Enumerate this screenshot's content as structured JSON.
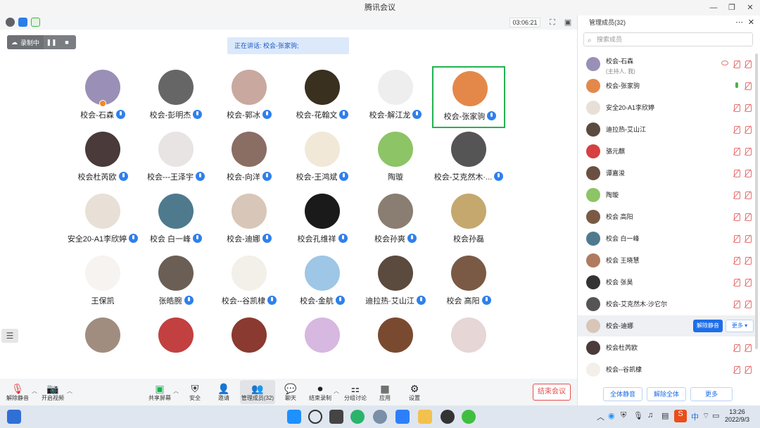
{
  "window": {
    "title": "腾讯会议",
    "timer": "03:06:21"
  },
  "recording": {
    "label": "录制中"
  },
  "speaker_banner": "正在讲话: 校会-张家驹;",
  "video_tiles": [
    {
      "name": "校会-石森",
      "mic": true,
      "host": true,
      "color": "#9a8fb6",
      "active": false
    },
    {
      "name": "校会-彭明杰",
      "mic": true,
      "color": "#666666",
      "active": false
    },
    {
      "name": "校会-郭冰",
      "mic": true,
      "color": "#c9a8a0",
      "active": false
    },
    {
      "name": "校会-花翰文",
      "mic": true,
      "color": "#3a3020",
      "active": false
    },
    {
      "name": "校会-解江龙",
      "mic": true,
      "color": "#eeeeee",
      "active": false
    },
    {
      "name": "校会-张家驹",
      "mic": true,
      "color": "#e4884a",
      "active": true
    },
    {
      "name": "校会杜芮欧",
      "mic": true,
      "color": "#4a3a3a",
      "active": false
    },
    {
      "name": "校会---王泽宇",
      "mic": true,
      "color": "#e9e4e4",
      "active": false
    },
    {
      "name": "校会-向洋",
      "mic": true,
      "color": "#8a6d63",
      "active": false
    },
    {
      "name": "校会-王鸿斌",
      "mic": true,
      "color": "#f2e8d8",
      "active": false
    },
    {
      "name": "陶璇",
      "mic": false,
      "color": "#8cc466",
      "active": false
    },
    {
      "name": "校会-艾克然木·...",
      "mic": true,
      "color": "#555555",
      "active": false
    },
    {
      "name": "安全20-A1李欣婷",
      "mic": true,
      "color": "#e8e0d6",
      "active": false
    },
    {
      "name": "校会 白一峰",
      "mic": true,
      "color": "#4f7a8e",
      "active": false
    },
    {
      "name": "校会-迪娜",
      "mic": true,
      "color": "#d8c6b8",
      "active": false
    },
    {
      "name": "校会孔维祥",
      "mic": true,
      "color": "#1a1a1a",
      "active": false
    },
    {
      "name": "校会孙爽",
      "mic": true,
      "color": "#8a7e72",
      "active": false
    },
    {
      "name": "校会孙磊",
      "mic": false,
      "color": "#c4a86e",
      "active": false
    },
    {
      "name": "王保凯",
      "mic": false,
      "color": "#f6f3f0",
      "active": false
    },
    {
      "name": "张皓腕",
      "mic": true,
      "color": "#6b5e55",
      "active": false
    },
    {
      "name": "校会--谷凯棣",
      "mic": true,
      "color": "#f3efe9",
      "active": false
    },
    {
      "name": "校会-金航",
      "mic": true,
      "color": "#9ec6e6",
      "active": false
    },
    {
      "name": "迪拉热·艾山江",
      "mic": true,
      "color": "#5b4a3e",
      "active": false
    },
    {
      "name": "校会  高阳",
      "mic": true,
      "color": "#7a5a44",
      "active": false
    },
    {
      "name": "",
      "mic": false,
      "color": "#a08d80",
      "active": false
    },
    {
      "name": "",
      "mic": false,
      "color": "#c24040",
      "active": false
    },
    {
      "name": "",
      "mic": false,
      "color": "#8a3a30",
      "active": false
    },
    {
      "name": "",
      "mic": false,
      "color": "#d6b8e0",
      "active": false
    },
    {
      "name": "",
      "mic": false,
      "color": "#7a4a30",
      "active": false
    },
    {
      "name": "",
      "mic": false,
      "color": "#e6d6d6",
      "active": false
    }
  ],
  "toolbar": {
    "unmute": "解除静音",
    "video": "开启视频",
    "share": "共享屏幕",
    "security": "安全",
    "invite": "邀请",
    "members": "管理成员(32)",
    "chat": "聊天",
    "end_record": "结束录制",
    "breakout": "分组讨论",
    "apps": "应用",
    "settings": "设置",
    "end_meeting": "结束会议"
  },
  "panel": {
    "title": "管理成员(32)",
    "search_placeholder": "搜索成员",
    "members": [
      {
        "name": "校会-石森",
        "sub": "(主持人, 我)",
        "mic": "off",
        "cam": "off",
        "eye": true,
        "color": "#9a8fb6"
      },
      {
        "name": "校会-张家驹",
        "sub": "",
        "mic": "on",
        "cam": "off",
        "color": "#e4884a"
      },
      {
        "name": "安全20-A1李欣婷",
        "sub": "",
        "mic": "off",
        "cam": "off",
        "color": "#e8e0d6"
      },
      {
        "name": "迪拉热-艾山江",
        "sub": "",
        "mic": "off",
        "cam": "off",
        "color": "#5b4a3e"
      },
      {
        "name": "骆元麒",
        "sub": "",
        "mic": "off",
        "cam": "off",
        "color": "#d64040"
      },
      {
        "name": "谭嘉浚",
        "sub": "",
        "mic": "off",
        "cam": "off",
        "color": "#6a5040"
      },
      {
        "name": "陶璇",
        "sub": "",
        "mic": "off",
        "cam": "off",
        "color": "#8cc466"
      },
      {
        "name": "校会  高阳",
        "sub": "",
        "mic": "off",
        "cam": "off",
        "color": "#7a5a44"
      },
      {
        "name": "校会 白一峰",
        "sub": "",
        "mic": "off",
        "cam": "off",
        "color": "#4f7a8e"
      },
      {
        "name": "校会 王晓慧",
        "sub": "",
        "mic": "off",
        "cam": "off",
        "color": "#b07a60"
      },
      {
        "name": "校会 张昊",
        "sub": "",
        "mic": "off",
        "cam": "off",
        "color": "#333333"
      },
      {
        "name": "校会-艾克然木·沙它尔",
        "sub": "",
        "mic": "off",
        "cam": "off",
        "color": "#555555"
      },
      {
        "name": "校会-迪娜",
        "sub": "",
        "mic": "",
        "cam": "",
        "color": "#d8c6b8",
        "highlight": true
      },
      {
        "name": "校会杜芮欧",
        "sub": "",
        "mic": "off",
        "cam": "off",
        "color": "#4a3a3a"
      },
      {
        "name": "校会--谷凯棣",
        "sub": "",
        "mic": "off",
        "cam": "off",
        "color": "#f3efe9"
      }
    ],
    "unmute_btn": "解除静音",
    "more_btn": "更多 ▾",
    "mute_all": "全体静音",
    "unmute_all": "解除全体",
    "more_foot": "更多"
  },
  "taskbar": {
    "ime": "中",
    "time": "13:26",
    "date": "2022/9/3"
  }
}
